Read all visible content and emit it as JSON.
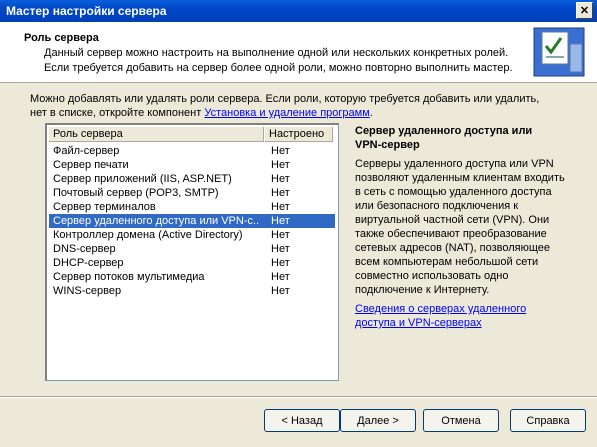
{
  "window": {
    "title": "Мастер настройки сервера",
    "close_glyph": "✕"
  },
  "header": {
    "title": "Роль сервера",
    "desc_line1": "Данный сервер можно настроить на выполнение одной или нескольких конкретных ролей.",
    "desc_line2": "Если требуется добавить на сервер более одной роли, можно повторно выполнить мастер.",
    "icon": "wizard-checklist-icon"
  },
  "intro": {
    "line1": "Можно добавлять или удалять роли сервера. Если роли, которую требуется добавить или удалить,",
    "line2_prefix": "нет в списке, откройте компонент ",
    "link": "Установка и удаление программ",
    "line2_suffix": "."
  },
  "list": {
    "headers": [
      "Роль сервера",
      "Настроено"
    ],
    "rows": [
      {
        "role": "Файл-сервер",
        "configured": "Нет"
      },
      {
        "role": "Сервер печати",
        "configured": "Нет"
      },
      {
        "role": "Сервер приложений (IIS, ASP.NET)",
        "configured": "Нет"
      },
      {
        "role": "Почтовый сервер (POP3, SMTP)",
        "configured": "Нет"
      },
      {
        "role": "Сервер терминалов",
        "configured": "Нет"
      },
      {
        "role": "Сервер удаленного доступа или VPN-с...",
        "configured": "Нет"
      },
      {
        "role": "Контроллер домена (Active Directory)",
        "configured": "Нет"
      },
      {
        "role": "DNS-сервер",
        "configured": "Нет"
      },
      {
        "role": "DHCP-сервер",
        "configured": "Нет"
      },
      {
        "role": "Сервер потоков мультимедиа",
        "configured": "Нет"
      },
      {
        "role": "WINS-сервер",
        "configured": "Нет"
      }
    ],
    "selected_index": 5
  },
  "panel": {
    "title_line1": "Сервер удаленного доступа или",
    "title_line2": "VPN-сервер",
    "desc": [
      "Серверы удаленного доступа или VPN",
      "позволяют удаленным клиентам входить",
      "в сеть с помощью удаленного доступа",
      "или безопасного подключения к",
      "виртуальной частной сети (VPN). Они",
      "также обеспечивают преобразование",
      "сетевых адресов (NAT), позволяющее",
      "всем компьютерам небольшой сети",
      "совместно использовать одно",
      "подключение к Интернету."
    ],
    "link_line1": "Сведения о серверах удаленного",
    "link_line2": "доступа и VPN-серверах"
  },
  "buttons": {
    "back": "< Назад",
    "next": "Далее >",
    "cancel": "Отмена",
    "help": "Справка"
  }
}
